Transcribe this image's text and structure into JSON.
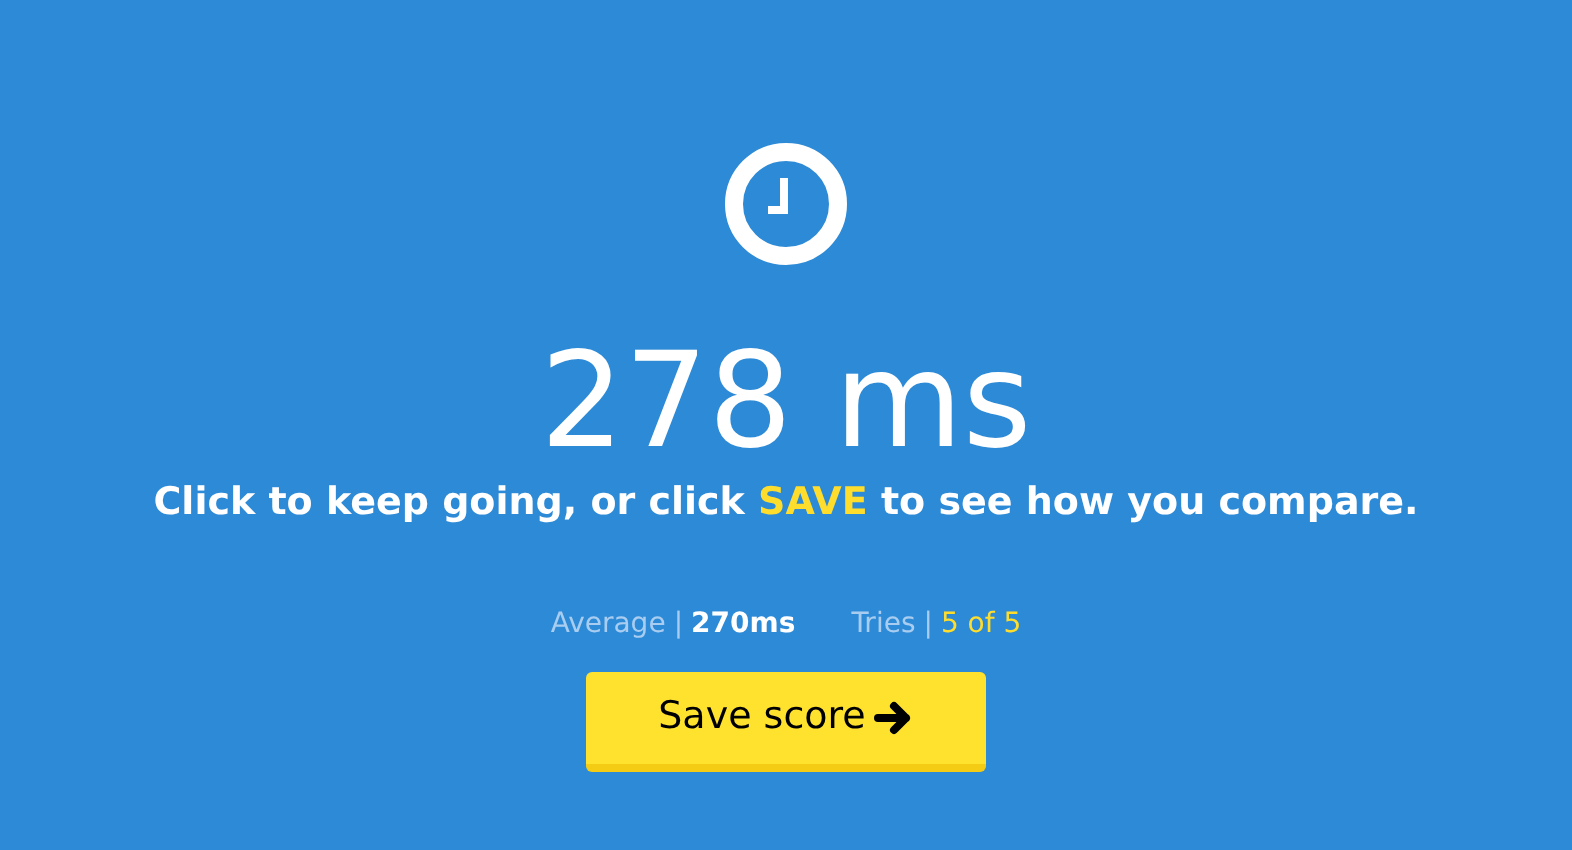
{
  "result": "278 ms",
  "instruction": {
    "before": "Click to keep going, or click ",
    "highlight": "SAVE",
    "after": " to see how you compare."
  },
  "stats": [
    {
      "label": "Average",
      "separator": "|",
      "value": "270ms",
      "highlight": false
    },
    {
      "label": "Tries",
      "separator": "|",
      "value": "5 of 5",
      "highlight": true
    }
  ],
  "save_button": {
    "label": "Save score"
  }
}
